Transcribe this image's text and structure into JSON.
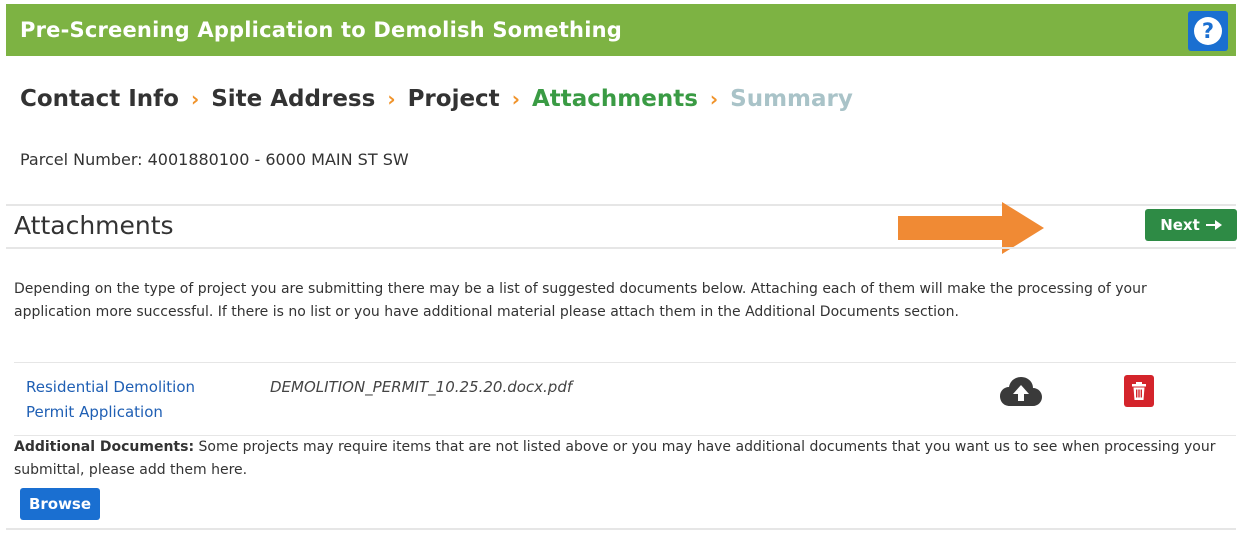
{
  "header": {
    "title": "Pre-Screening Application to Demolish Something",
    "help_glyph": "?",
    "color": "#7db343"
  },
  "breadcrumb": [
    {
      "label": "Contact Info",
      "state": "done"
    },
    {
      "label": "Site Address",
      "state": "done"
    },
    {
      "label": "Project",
      "state": "done"
    },
    {
      "label": "Attachments",
      "state": "active"
    },
    {
      "label": "Summary",
      "state": "future"
    }
  ],
  "breadcrumb_separator": "›",
  "parcel": {
    "text": "Parcel Number: 4001880100 - 6000 MAIN ST SW"
  },
  "section": {
    "title": "Attachments",
    "next_label": "Next"
  },
  "description": "Depending on the type of project you are submitting there may be a list of suggested documents below. Attaching each of them will make the processing of your application more successful. If there is no list or you have additional material please attach them in the Additional Documents section.",
  "documents": [
    {
      "name": "Residential Demolition Permit Application",
      "file": "DEMOLITION_PERMIT_10.25.20.docx.pdf"
    }
  ],
  "additional": {
    "label": "Additional Documents:",
    "text": "Some projects may require items that are not listed above or you may have additional documents that you want us to see when processing your submittal, please add them here.",
    "browse_label": "Browse"
  },
  "colors": {
    "green": "#7db343",
    "active_step": "#3a9b44",
    "future_step": "#a9c3c8",
    "separator": "#f0932a",
    "next_button": "#2e8b45",
    "blue_button": "#1a6fd1",
    "delete_button": "#d4242b",
    "annotation_arrow": "#f08a34"
  }
}
